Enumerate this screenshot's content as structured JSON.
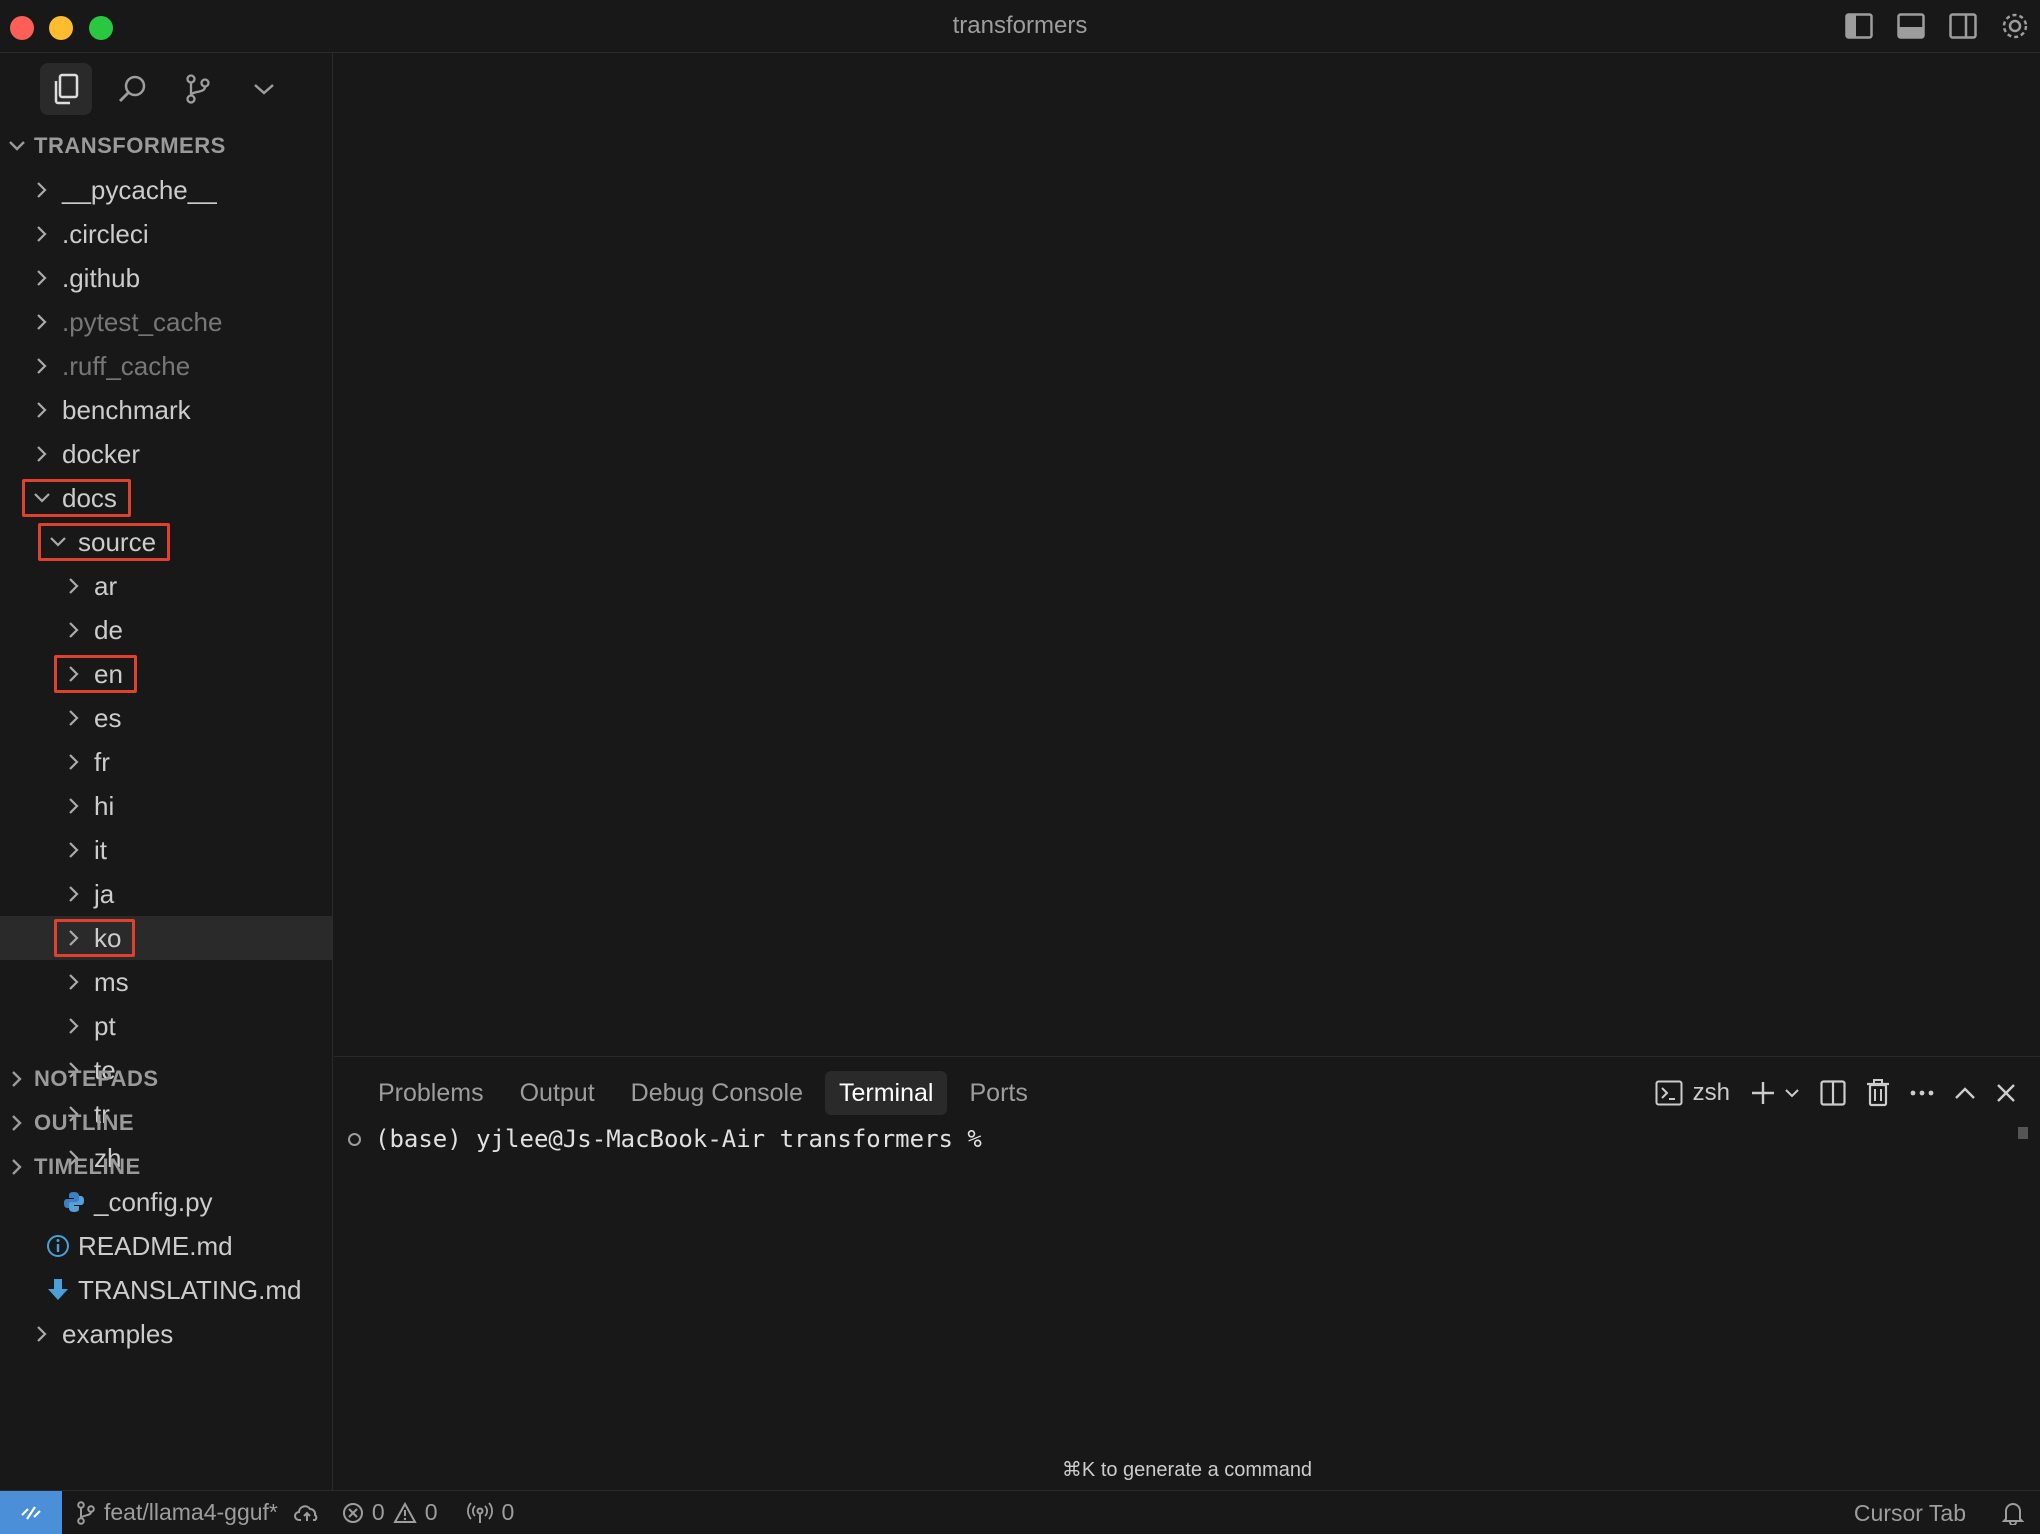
{
  "window": {
    "title": "transformers"
  },
  "explorer": {
    "root_label": "TRANSFORMERS",
    "items": [
      {
        "label": "__pycache__",
        "type": "folder",
        "expanded": false,
        "depth": 0,
        "dim": false
      },
      {
        "label": ".circleci",
        "type": "folder",
        "expanded": false,
        "depth": 0,
        "dim": false
      },
      {
        "label": ".github",
        "type": "folder",
        "expanded": false,
        "depth": 0,
        "dim": false
      },
      {
        "label": ".pytest_cache",
        "type": "folder",
        "expanded": false,
        "depth": 0,
        "dim": true
      },
      {
        "label": ".ruff_cache",
        "type": "folder",
        "expanded": false,
        "depth": 0,
        "dim": true
      },
      {
        "label": "benchmark",
        "type": "folder",
        "expanded": false,
        "depth": 0,
        "dim": false
      },
      {
        "label": "docker",
        "type": "folder",
        "expanded": false,
        "depth": 0,
        "dim": false
      },
      {
        "label": "docs",
        "type": "folder",
        "expanded": true,
        "depth": 0,
        "dim": false
      },
      {
        "label": "source",
        "type": "folder",
        "expanded": true,
        "depth": 1,
        "dim": false
      },
      {
        "label": "ar",
        "type": "folder",
        "expanded": false,
        "depth": 2,
        "dim": false
      },
      {
        "label": "de",
        "type": "folder",
        "expanded": false,
        "depth": 2,
        "dim": false
      },
      {
        "label": "en",
        "type": "folder",
        "expanded": false,
        "depth": 2,
        "dim": false
      },
      {
        "label": "es",
        "type": "folder",
        "expanded": false,
        "depth": 2,
        "dim": false
      },
      {
        "label": "fr",
        "type": "folder",
        "expanded": false,
        "depth": 2,
        "dim": false
      },
      {
        "label": "hi",
        "type": "folder",
        "expanded": false,
        "depth": 2,
        "dim": false
      },
      {
        "label": "it",
        "type": "folder",
        "expanded": false,
        "depth": 2,
        "dim": false
      },
      {
        "label": "ja",
        "type": "folder",
        "expanded": false,
        "depth": 2,
        "dim": false
      },
      {
        "label": "ko",
        "type": "folder",
        "expanded": false,
        "depth": 2,
        "dim": false
      },
      {
        "label": "ms",
        "type": "folder",
        "expanded": false,
        "depth": 2,
        "dim": false
      },
      {
        "label": "pt",
        "type": "folder",
        "expanded": false,
        "depth": 2,
        "dim": false
      },
      {
        "label": "te",
        "type": "folder",
        "expanded": false,
        "depth": 2,
        "dim": false
      },
      {
        "label": "tr",
        "type": "folder",
        "expanded": false,
        "depth": 2,
        "dim": false
      },
      {
        "label": "zh",
        "type": "folder",
        "expanded": false,
        "depth": 2,
        "dim": false
      },
      {
        "label": "_config.py",
        "type": "file",
        "icon": "python-icon",
        "depth": 2,
        "dim": false
      },
      {
        "label": "README.md",
        "type": "file",
        "icon": "info-icon",
        "depth": 1,
        "dim": false
      },
      {
        "label": "TRANSLATING.md",
        "type": "file",
        "icon": "download-arrow-icon",
        "depth": 1,
        "dim": false
      },
      {
        "label": "examples",
        "type": "folder",
        "expanded": false,
        "depth": 0,
        "dim": false
      }
    ],
    "selected": "ko",
    "highlighted": [
      "docs",
      "source",
      "en",
      "ko"
    ]
  },
  "sections": {
    "notepads": "NOTEPADS",
    "outline": "OUTLINE",
    "timeline": "TIMELINE"
  },
  "panel": {
    "tabs": [
      "Problems",
      "Output",
      "Debug Console",
      "Terminal",
      "Ports"
    ],
    "active_tab": "Terminal",
    "shell_label": "zsh",
    "terminal_line": "(base) yjlee@Js-MacBook-Air transformers %",
    "hint": "⌘K to generate a command"
  },
  "statusbar": {
    "branch": "feat/llama4-gguf*",
    "errors": "0",
    "warnings": "0",
    "ports": "0",
    "cursor_tab": "Cursor Tab"
  },
  "colors": {
    "highlight_box": "#e0412f",
    "remote_indicator": "#4a8fd8",
    "python_icon": "#3b7fc4"
  }
}
